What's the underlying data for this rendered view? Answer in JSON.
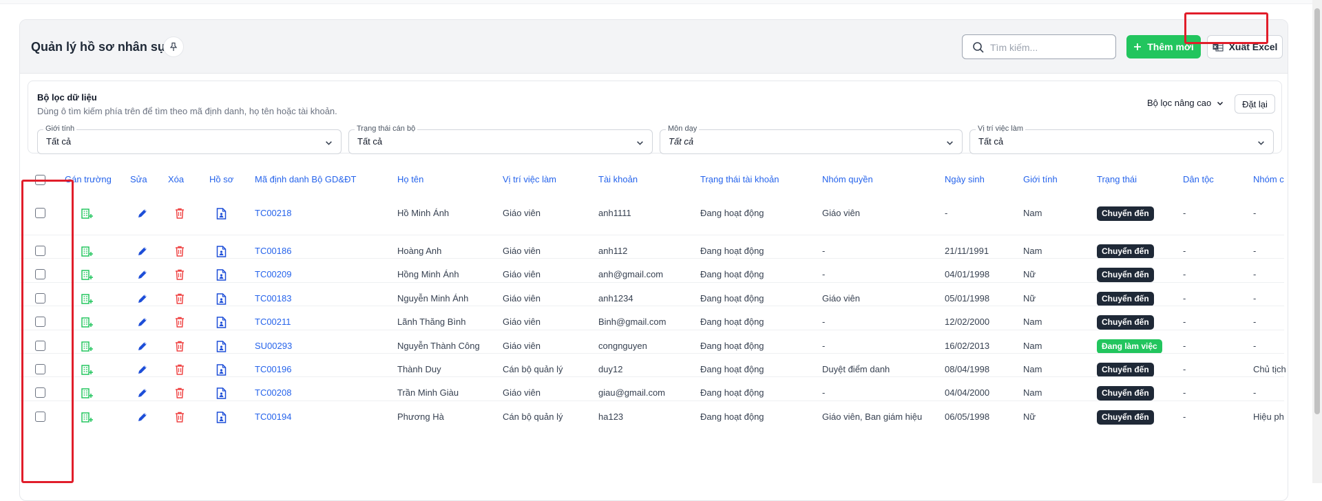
{
  "header": {
    "title": "Quản lý hồ sơ nhân sự",
    "search_placeholder": "Tìm kiếm...",
    "add_label": "Thêm mới",
    "export_label": "Xuất Excel"
  },
  "filters": {
    "title": "Bộ lọc dữ liệu",
    "hint": "Dùng ô tìm kiếm phía trên để tìm theo mã định danh, họ tên hoặc tài khoản.",
    "advanced_label": "Bộ lọc nâng cao",
    "reset_label": "Đặt lại",
    "fields": [
      {
        "label": "Giới tính",
        "value": "Tất cả"
      },
      {
        "label": "Trạng thái cán bộ",
        "value": "Tất cả"
      },
      {
        "label": "Môn dạy",
        "value": "Tất cả"
      },
      {
        "label": "Vị trí việc làm",
        "value": "Tất cả"
      }
    ]
  },
  "table": {
    "columns": [
      "Gán trường",
      "Sửa",
      "Xóa",
      "Hồ sơ",
      "Mã định danh Bộ GD&ĐT",
      "Họ tên",
      "Vị trí việc làm",
      "Tài khoản",
      "Trạng thái tài khoản",
      "Nhóm quyền",
      "Ngày sinh",
      "Giới tính",
      "Trạng thái",
      "Dân tộc",
      "Nhóm c"
    ],
    "rows": [
      {
        "id": "TC00218",
        "name": "Hồ Minh Ánh",
        "position": "Giáo viên",
        "account": "anh1111",
        "account_status": "Đang hoạt động",
        "role": "Giáo viên",
        "dob": "-",
        "gender": "Nam",
        "status": "Chuyển đến",
        "ethnic": "-",
        "group": "-"
      },
      {
        "id": "TC00186",
        "name": "Hoàng Anh",
        "position": "Giáo viên",
        "account": "anh112",
        "account_status": "Đang hoạt động",
        "role": "-",
        "dob": "21/11/1991",
        "gender": "Nam",
        "status": "Chuyển đến",
        "ethnic": "-",
        "group": "-"
      },
      {
        "id": "TC00209",
        "name": "Hồng Minh Ánh",
        "position": "Giáo viên",
        "account": "anh@gmail.com",
        "account_status": "Đang hoạt động",
        "role": "-",
        "dob": "04/01/1998",
        "gender": "Nữ",
        "status": "Chuyển đến",
        "ethnic": "-",
        "group": "-"
      },
      {
        "id": "TC00183",
        "name": "Nguyễn Minh Ánh",
        "position": "Giáo viên",
        "account": "anh1234",
        "account_status": "Đang hoạt động",
        "role": "Giáo viên",
        "dob": "05/01/1998",
        "gender": "Nữ",
        "status": "Chuyển đến",
        "ethnic": "-",
        "group": "-"
      },
      {
        "id": "TC00211",
        "name": "Lãnh Thăng Bình",
        "position": "Giáo viên",
        "account": "Binh@gmail.com",
        "account_status": "Đang hoạt động",
        "role": "-",
        "dob": "12/02/2000",
        "gender": "Nam",
        "status": "Chuyển đến",
        "ethnic": "-",
        "group": "-"
      },
      {
        "id": "SU00293",
        "name": "Nguyễn Thành Công",
        "position": "Giáo viên",
        "account": "congnguyen",
        "account_status": "Đang hoạt động",
        "role": "-",
        "dob": "16/02/2013",
        "gender": "Nam",
        "status": "Đang làm việc",
        "ethnic": "-",
        "group": "-"
      },
      {
        "id": "TC00196",
        "name": "Thành Duy",
        "position": "Cán bộ quản lý",
        "account": "duy12",
        "account_status": "Đang hoạt động",
        "role": "Duyệt điểm danh",
        "dob": "08/04/1998",
        "gender": "Nam",
        "status": "Chuyển đến",
        "ethnic": "-",
        "group": "Chủ tịch"
      },
      {
        "id": "TC00208",
        "name": "Trần Minh Giàu",
        "position": "Giáo viên",
        "account": "giau@gmail.com",
        "account_status": "Đang hoạt động",
        "role": "-",
        "dob": "04/04/2000",
        "gender": "Nam",
        "status": "Chuyển đến",
        "ethnic": "-",
        "group": "-"
      },
      {
        "id": "TC00194",
        "name": "Phương Hà",
        "position": "Cán bộ quản lý",
        "account": "ha123",
        "account_status": "Đang hoạt động",
        "role": "Giáo viên, Ban giám hiệu",
        "dob": "06/05/1998",
        "gender": "Nữ",
        "status": "Chuyển đến",
        "ethnic": "-",
        "group": "Hiệu ph"
      }
    ]
  },
  "colors": {
    "link": "#2563eb",
    "green": "#22c55e",
    "badge_dark": "#1f2937",
    "delete": "#ef4444",
    "edit": "#1d4ed8",
    "highlight": "#e11d2a"
  }
}
